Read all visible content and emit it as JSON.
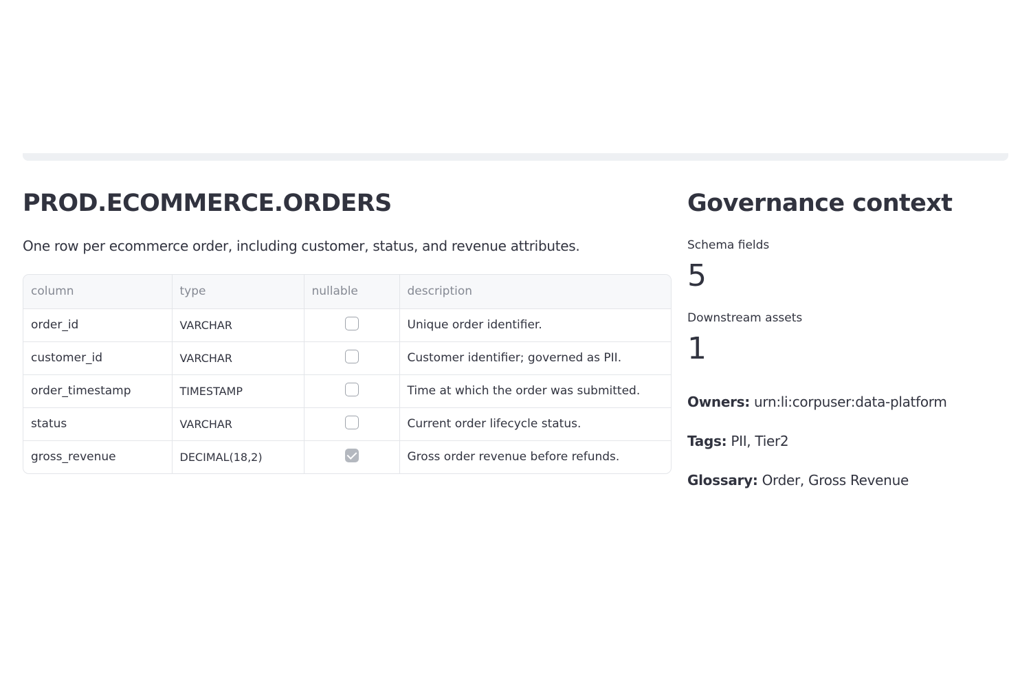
{
  "dataset": {
    "title": "PROD.ECOMMERCE.ORDERS",
    "description": "One row per ecommerce order, including customer, status, and revenue attributes."
  },
  "schema_table": {
    "headers": {
      "column": "column",
      "type": "type",
      "nullable": "nullable",
      "description": "description"
    },
    "rows": [
      {
        "column": "order_id",
        "type": "VARCHAR",
        "nullable": false,
        "description": "Unique order identifier."
      },
      {
        "column": "customer_id",
        "type": "VARCHAR",
        "nullable": false,
        "description": "Customer identifier; governed as PII."
      },
      {
        "column": "order_timestamp",
        "type": "TIMESTAMP",
        "nullable": false,
        "description": "Time at which the order was submitted."
      },
      {
        "column": "status",
        "type": "VARCHAR",
        "nullable": false,
        "description": "Current order lifecycle status."
      },
      {
        "column": "gross_revenue",
        "type": "DECIMAL(18,2)",
        "nullable": true,
        "description": "Gross order revenue before refunds."
      }
    ]
  },
  "governance": {
    "title": "Governance context",
    "schema_fields_label": "Schema fields",
    "schema_fields_value": "5",
    "downstream_label": "Downstream assets",
    "downstream_value": "1",
    "owners_label": "Owners:",
    "owners_value": "urn:li:corpuser:data-platform",
    "tags_label": "Tags:",
    "tags_value": "PII, Tier2",
    "glossary_label": "Glossary:",
    "glossary_value": "Order, Gross Revenue"
  },
  "colors": {
    "text": "#31333f",
    "header_text": "#858993",
    "border": "#e3e5e9",
    "header_bg": "#f7f8fa",
    "checked_box": "#b4b8bf"
  }
}
